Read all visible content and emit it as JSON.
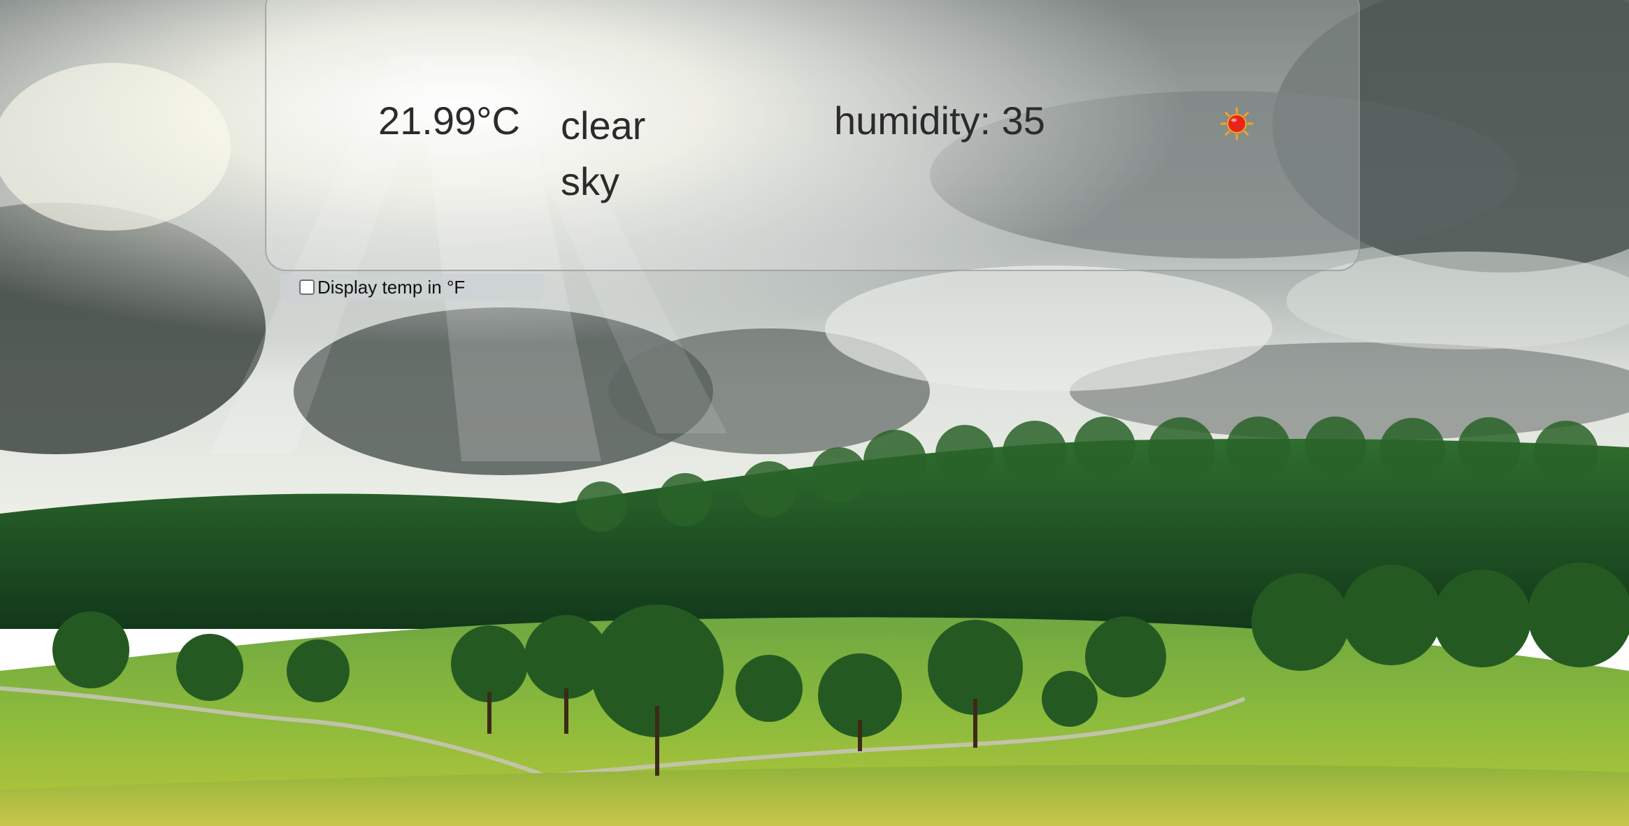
{
  "weather": {
    "temperature": "21.99°C",
    "description": "clear sky",
    "humidity": "humidity: 35",
    "icon": "sun-icon"
  },
  "settings": {
    "unit_toggle_label": "Display temp in °F",
    "unit_toggle_checked": false
  },
  "colors": {
    "sun": "#e8231a",
    "sun_rays": "#f5a31f",
    "text": "#2b2b2b"
  }
}
